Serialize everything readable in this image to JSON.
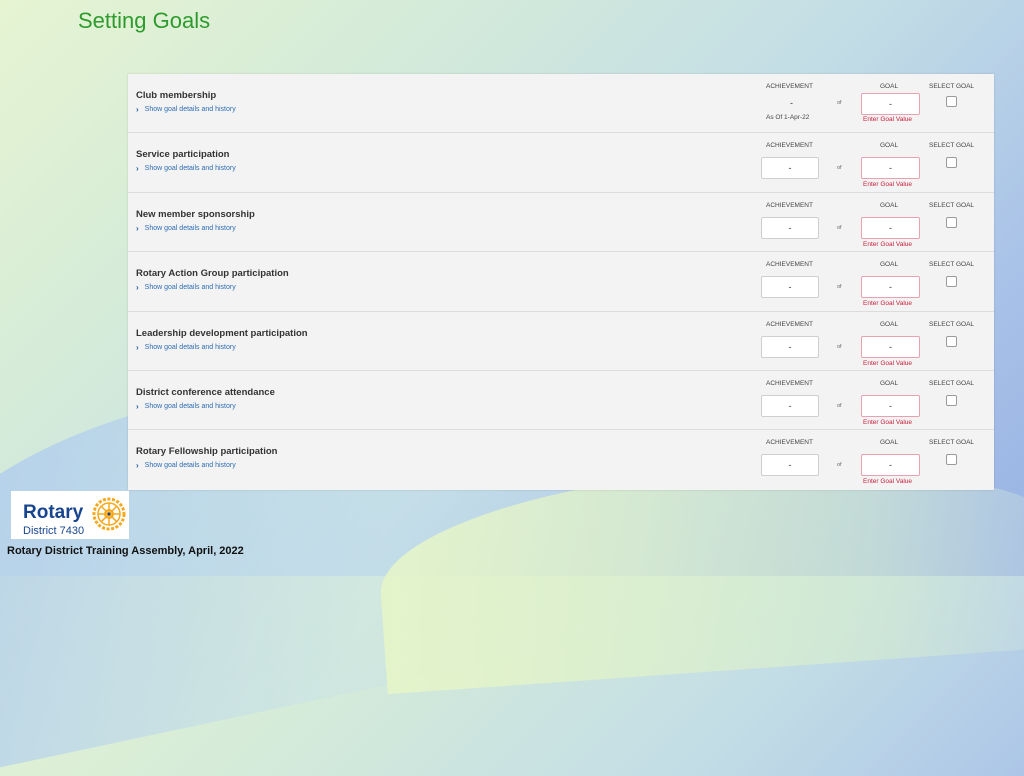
{
  "slide": {
    "title": "Setting Goals",
    "footer": "Rotary District Training Assembly, April, 2022"
  },
  "logo": {
    "word": "Rotary",
    "district": "District 7430",
    "icon": "rotary-wheel-icon"
  },
  "columns": {
    "achievement": "ACHIEVEMENT",
    "goal": "GOAL",
    "select": "SELECT GOAL",
    "of": "of"
  },
  "link_text": "Show goal details and history",
  "enter_value": "Enter Goal Value",
  "goals": [
    {
      "name": "Club membership",
      "achievement": "-",
      "as_of": "As Of 1-Apr-22",
      "goal": "-"
    },
    {
      "name": "Service participation",
      "achievement": "-",
      "goal": "-"
    },
    {
      "name": "New member sponsorship",
      "achievement": "-",
      "goal": "-"
    },
    {
      "name": "Rotary Action Group participation",
      "achievement": "-",
      "goal": "-"
    },
    {
      "name": "Leadership development participation",
      "achievement": "-",
      "goal": "-"
    },
    {
      "name": "District conference attendance",
      "achievement": "-",
      "goal": "-"
    },
    {
      "name": "Rotary Fellowship participation",
      "achievement": "-",
      "goal": "-"
    }
  ],
  "colors": {
    "title": "#2e9b2e",
    "rotary_blue": "#17458f",
    "rotary_gold": "#f7a81b",
    "error": "#c8203c",
    "link": "#2e6db4"
  }
}
